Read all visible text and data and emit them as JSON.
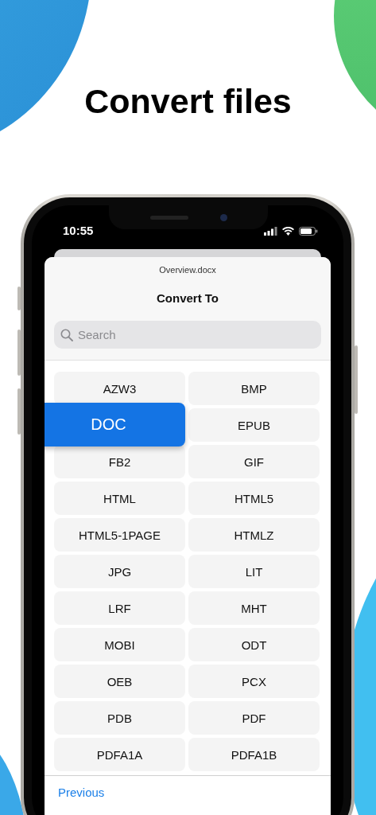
{
  "headline": "Convert files",
  "status_bar": {
    "time": "10:55"
  },
  "sheet": {
    "file_name": "Overview.docx",
    "title": "Convert To",
    "search": {
      "placeholder": "Search"
    },
    "formats": [
      {
        "label": "AZW3",
        "selected": false
      },
      {
        "label": "BMP",
        "selected": false
      },
      {
        "label": "DOC",
        "selected": true
      },
      {
        "label": "EPUB",
        "selected": false
      },
      {
        "label": "FB2",
        "selected": false
      },
      {
        "label": "GIF",
        "selected": false
      },
      {
        "label": "HTML",
        "selected": false
      },
      {
        "label": "HTML5",
        "selected": false
      },
      {
        "label": "HTML5-1PAGE",
        "selected": false
      },
      {
        "label": "HTMLZ",
        "selected": false
      },
      {
        "label": "JPG",
        "selected": false
      },
      {
        "label": "LIT",
        "selected": false
      },
      {
        "label": "LRF",
        "selected": false
      },
      {
        "label": "MHT",
        "selected": false
      },
      {
        "label": "MOBI",
        "selected": false
      },
      {
        "label": "ODT",
        "selected": false
      },
      {
        "label": "OEB",
        "selected": false
      },
      {
        "label": "PCX",
        "selected": false
      },
      {
        "label": "PDB",
        "selected": false
      },
      {
        "label": "PDF",
        "selected": false
      },
      {
        "label": "PDFA1A",
        "selected": false
      },
      {
        "label": "PDFA1B",
        "selected": false
      }
    ],
    "footer": {
      "previous": "Previous"
    }
  }
}
